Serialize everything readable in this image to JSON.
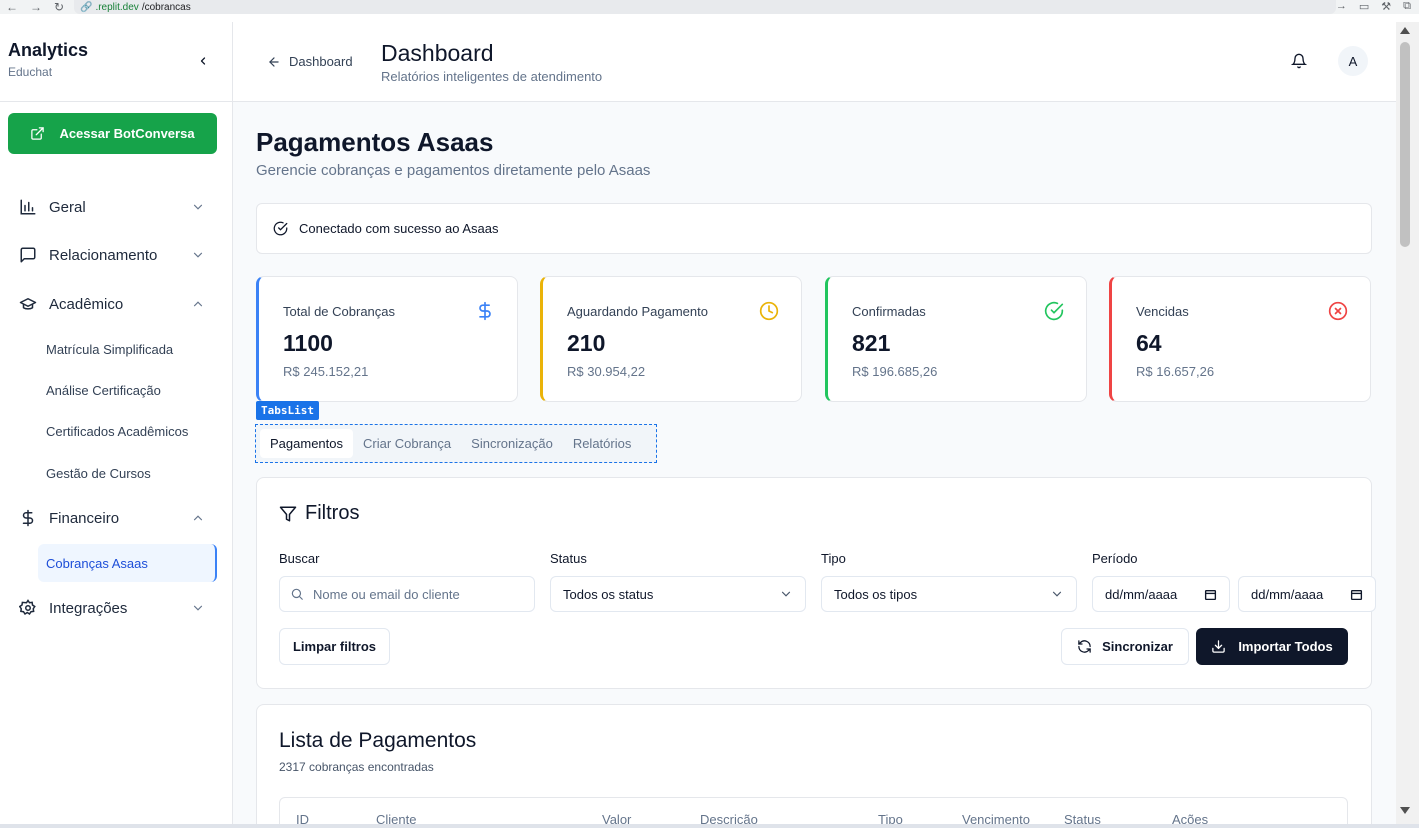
{
  "browser": {
    "url_host": ".replit.dev",
    "url_path": "/cobrancas"
  },
  "sidebar": {
    "title": "Analytics",
    "subtitle": "Educhat",
    "cta_label": "Acessar BotConversa",
    "groups": [
      {
        "label": "Geral"
      },
      {
        "label": "Relacionamento"
      },
      {
        "label": "Acadêmico"
      },
      {
        "label": "Financeiro"
      },
      {
        "label": "Integrações"
      }
    ],
    "academic_items": [
      "Matrícula Simplificada",
      "Análise Certificação",
      "Certificados Acadêmicos",
      "Gestão de Cursos"
    ],
    "financial_items": [
      "Cobranças Asaas"
    ]
  },
  "header": {
    "back_label": "Dashboard",
    "title": "Dashboard",
    "subtitle": "Relatórios inteligentes de atendimento",
    "avatar_initial": "A"
  },
  "page": {
    "title": "Pagamentos Asaas",
    "subtitle": "Gerencie cobranças e pagamentos diretamente pelo Asaas",
    "alert": "Conectado com sucesso ao Asaas"
  },
  "stats": [
    {
      "label": "Total de Cobranças",
      "value": "1100",
      "amount": "R$ 245.152,21",
      "color": "#3b82f6"
    },
    {
      "label": "Aguardando Pagamento",
      "value": "210",
      "amount": "R$ 30.954,22",
      "color": "#eab308"
    },
    {
      "label": "Confirmadas",
      "value": "821",
      "amount": "R$ 196.685,26",
      "color": "#22c55e"
    },
    {
      "label": "Vencidas",
      "value": "64",
      "amount": "R$ 16.657,26",
      "color": "#ef4444"
    }
  ],
  "tabs": {
    "tag": "TabsList",
    "items": [
      "Pagamentos",
      "Criar Cobrança",
      "Sincronização",
      "Relatórios"
    ]
  },
  "filters": {
    "title": "Filtros",
    "search_label": "Buscar",
    "search_placeholder": "Nome ou email do cliente",
    "status_label": "Status",
    "status_value": "Todos os status",
    "type_label": "Tipo",
    "type_value": "Todos os tipos",
    "period_label": "Período",
    "date_from": "dd/mm/aaaa",
    "date_to": "dd/mm/aaaa",
    "clear_label": "Limpar filtros",
    "sync_label": "Sincronizar",
    "import_label": "Importar Todos"
  },
  "payments_list": {
    "title": "Lista de Pagamentos",
    "count_text": "2317 cobranças encontradas",
    "columns": [
      "ID",
      "Cliente",
      "Valor",
      "Descrição",
      "Tipo",
      "Vencimento",
      "Status",
      "Ações"
    ]
  }
}
